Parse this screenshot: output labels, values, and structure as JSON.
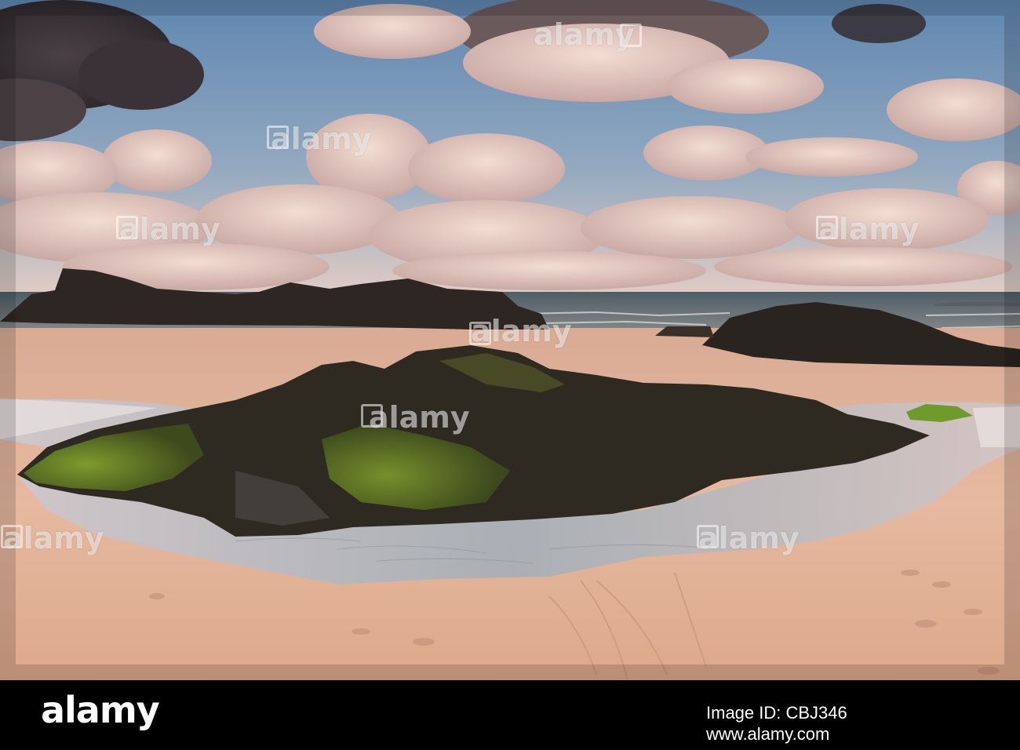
{
  "watermark": {
    "text": "alamy"
  },
  "footer": {
    "logo": "alamy",
    "image_id": "Image ID: CBJ346",
    "url": "www.alamy.com"
  },
  "colors": {
    "sky_top": "#6f93b8",
    "cloud": "#e9c8b8",
    "sand": "#e3b79e",
    "rock": "#2b2622",
    "moss": "#6b8a2a",
    "pool": "#b9c2c8",
    "footer_bg": "#000000"
  }
}
